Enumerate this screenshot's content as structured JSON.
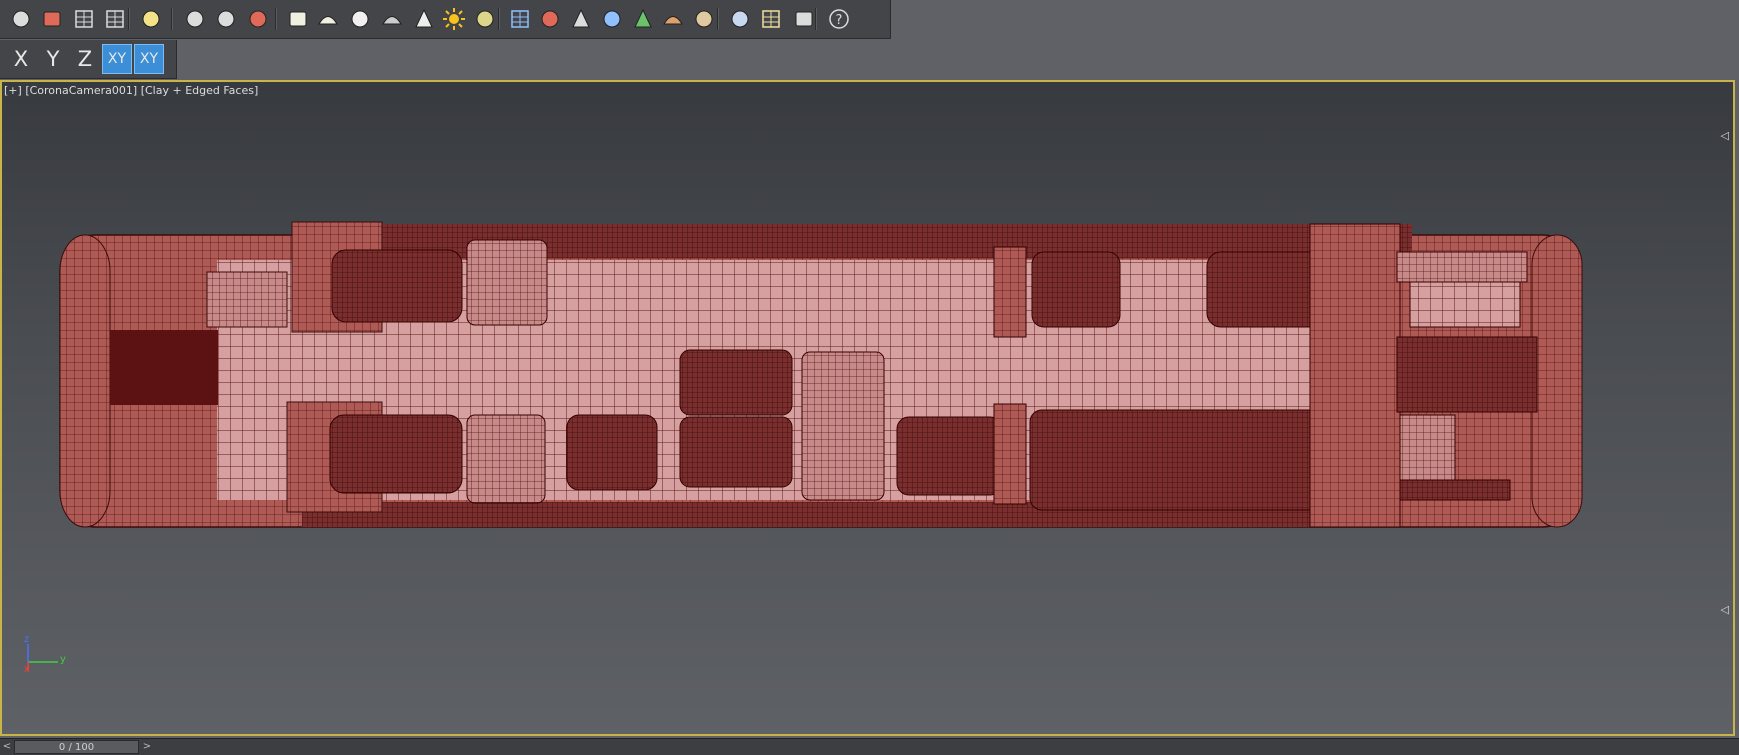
{
  "toolbar": {
    "buttons": [
      {
        "name": "teapot-render-icon",
        "color": "#dcdcdc"
      },
      {
        "name": "render-frame-icon",
        "color": "#e06a5a"
      },
      {
        "name": "render-setup-icon",
        "color": "#dcdcdc"
      },
      {
        "name": "render-elements-icon",
        "color": "#dcdcdc"
      },
      {
        "name": "light-lister-icon",
        "color": "#f3e28a"
      },
      {
        "name": "camera-icon",
        "color": "#dcdcdc"
      },
      {
        "name": "proxy-icon",
        "color": "#dcdcdc"
      },
      {
        "name": "vfb-camera-icon",
        "color": "#e06a5a"
      },
      {
        "name": "plane-light-icon",
        "color": "#f0f0e0"
      },
      {
        "name": "dome-light-icon",
        "color": "#f0f0e0"
      },
      {
        "name": "sphere-light-icon",
        "color": "#f0f0f0"
      },
      {
        "name": "material-teapot-icon",
        "color": "#cccccc"
      },
      {
        "name": "cone-light-icon",
        "color": "#eeeeee"
      },
      {
        "name": "sun-icon",
        "color": "#f6c21e"
      },
      {
        "name": "sky-sphere-icon",
        "color": "#ddd58a"
      },
      {
        "name": "scatter-icon",
        "color": "#8fc0ff"
      },
      {
        "name": "molecule-icon",
        "color": "#e06a5a"
      },
      {
        "name": "slicer-icon",
        "color": "#dcdcdc"
      },
      {
        "name": "gear-icon",
        "color": "#8fc0ff"
      },
      {
        "name": "grass-icon",
        "color": "#6ac26a"
      },
      {
        "name": "hair-fur-icon",
        "color": "#e0a06a"
      },
      {
        "name": "sound-icon",
        "color": "#e0c8a0"
      },
      {
        "name": "material-sphere-icon",
        "color": "#c8d8f0"
      },
      {
        "name": "converter-icon",
        "color": "#f0e0a0"
      },
      {
        "name": "layout-icon",
        "color": "#dcdcdc"
      },
      {
        "name": "help-icon",
        "color": "#dcdcdc"
      }
    ]
  },
  "axis_toolbar": {
    "x_label": "X",
    "y_label": "Y",
    "z_label": "Z",
    "xy_label": "XY",
    "xy_snap_label": "XY"
  },
  "viewport": {
    "label_plus": "[+]",
    "label_camera": "[CoronaCamera001]",
    "label_shading": "[Clay + Edged Faces]",
    "border_color": "#c9b44a",
    "model_color": "#c26a66",
    "wire_color": "#4b1414"
  },
  "gizmo": {
    "x_label": "x",
    "y_label": "y",
    "z_label": "z"
  },
  "timeline": {
    "frame_text": "0 / 100",
    "prev_label": "<",
    "next_label": ">"
  }
}
